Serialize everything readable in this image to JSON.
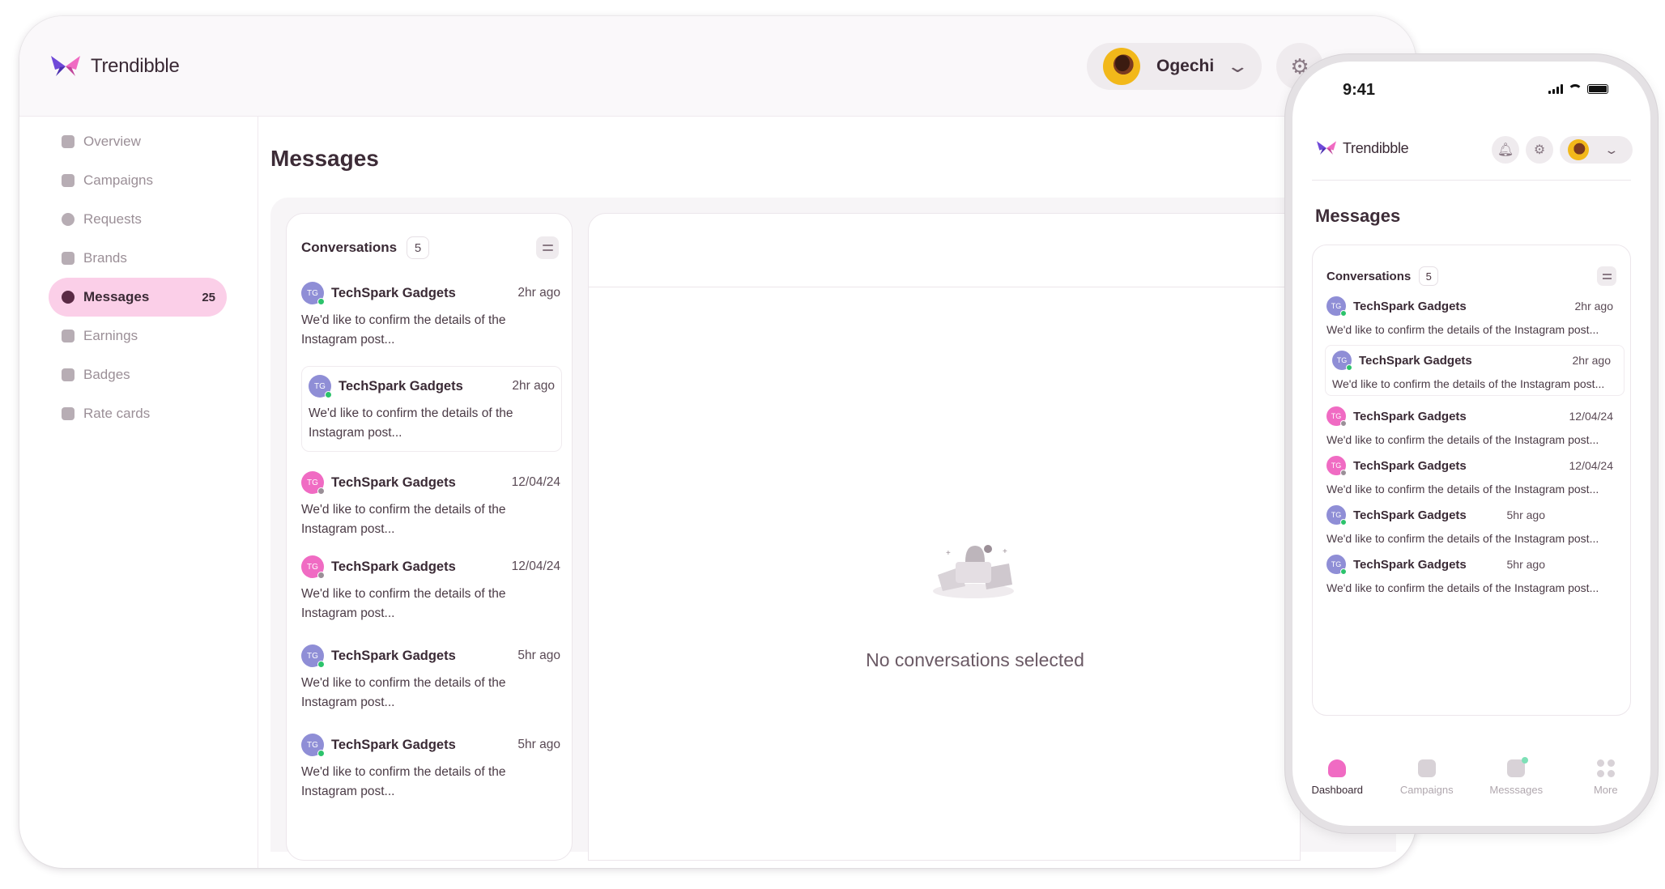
{
  "app": {
    "name": "Trendibble"
  },
  "header": {
    "user_name": "Ogechi"
  },
  "sidebar": {
    "items": [
      {
        "label": "Overview"
      },
      {
        "label": "Campaigns"
      },
      {
        "label": "Requests"
      },
      {
        "label": "Brands"
      },
      {
        "label": "Messages",
        "badge": "25",
        "active": true
      },
      {
        "label": "Earnings"
      },
      {
        "label": "Badges"
      },
      {
        "label": "Rate cards"
      }
    ]
  },
  "main": {
    "title": "Messages",
    "conversations": {
      "title": "Conversations",
      "count": "5",
      "items": [
        {
          "initials": "TG",
          "name": "TechSpark Gadgets",
          "time": "2hr ago",
          "message": "We'd like to confirm the details of the Instagram post...",
          "avatar_color": "blue",
          "status": "online"
        },
        {
          "initials": "TG",
          "name": "TechSpark Gadgets",
          "time": "2hr ago",
          "message": "We'd like to confirm the details of the Instagram post...",
          "avatar_color": "blue",
          "status": "online",
          "selected": true
        },
        {
          "initials": "TG",
          "name": "TechSpark Gadgets",
          "time": "12/04/24",
          "message": "We'd like to confirm the details of the Instagram post...",
          "avatar_color": "pink",
          "status": "offline"
        },
        {
          "initials": "TG",
          "name": "TechSpark Gadgets",
          "time": "12/04/24",
          "message": "We'd like to confirm the details of the Instagram post...",
          "avatar_color": "pink",
          "status": "offline"
        },
        {
          "initials": "TG",
          "name": "TechSpark Gadgets",
          "time": "5hr ago",
          "message": "We'd like to confirm the details of the Instagram post...",
          "avatar_color": "blue",
          "status": "online"
        },
        {
          "initials": "TG",
          "name": "TechSpark Gadgets",
          "time": "5hr ago",
          "message": "We'd like to confirm the details of the Instagram post...",
          "avatar_color": "blue",
          "status": "online"
        }
      ]
    },
    "empty_state": "No conversations selected"
  },
  "phone": {
    "status_time": "9:41",
    "app_name": "Trendibble",
    "title": "Messages",
    "conversations_title": "Conversations",
    "conversations_count": "5",
    "tabs": [
      {
        "label": "Dashboard",
        "active": true
      },
      {
        "label": "Campaigns"
      },
      {
        "label": "Messsages"
      },
      {
        "label": "More"
      }
    ]
  },
  "colors": {
    "accent_pink": "#f06bc3",
    "active_nav_bg": "#fbcfe8",
    "online": "#2cc36b",
    "avatar_blue": "#8f8ed6"
  }
}
